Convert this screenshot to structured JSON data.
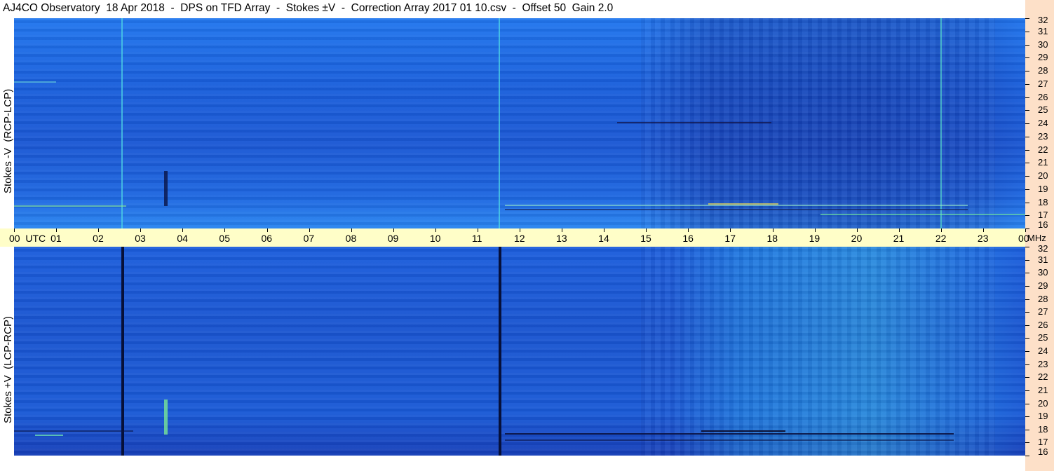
{
  "title": "AJ4CO Observatory  18 Apr 2018  -  DPS on TFD Array  -  Stokes ±V  -  Correction Array 2017 01 10.csv  -  Offset 50  Gain 2.0",
  "chart_data": [
    {
      "type": "heatmap",
      "ylabel": "Stokes -V  (RCP-LCP)",
      "ylim": [
        16,
        32
      ],
      "y_unit": "MHz",
      "x_ticks": [
        "00",
        "01",
        "02",
        "03",
        "04",
        "05",
        "06",
        "07",
        "08",
        "09",
        "10",
        "11",
        "12",
        "13",
        "14",
        "15",
        "16",
        "17",
        "18",
        "19",
        "20",
        "21",
        "22",
        "23",
        "00"
      ],
      "y_ticks": [
        "32",
        "31",
        "30",
        "29",
        "28",
        "27",
        "26",
        "25",
        "24",
        "23",
        "22",
        "21",
        "20",
        "19",
        "18",
        "17",
        "16"
      ],
      "colors": {
        "low": "#0a1a8a",
        "mid": "#1e64e0",
        "high": "#40e0d0"
      }
    },
    {
      "type": "heatmap",
      "ylabel": "Stokes +V  (LCP-RCP)",
      "ylim": [
        16,
        32
      ],
      "y_unit": "MHz",
      "x_ticks": [
        "00",
        "01",
        "02",
        "03",
        "04",
        "05",
        "06",
        "07",
        "08",
        "09",
        "10",
        "11",
        "12",
        "13",
        "14",
        "15",
        "16",
        "17",
        "18",
        "19",
        "20",
        "21",
        "22",
        "23",
        "00"
      ],
      "y_ticks": [
        "32",
        "31",
        "30",
        "29",
        "28",
        "27",
        "26",
        "25",
        "24",
        "23",
        "22",
        "21",
        "20",
        "19",
        "18",
        "17",
        "16"
      ],
      "colors": {
        "low": "#0a1a8a",
        "mid": "#1e5ad6",
        "high": "#40e0d0"
      }
    }
  ],
  "x_axis": {
    "first_label": "00  UTC",
    "unit": "MHz"
  }
}
